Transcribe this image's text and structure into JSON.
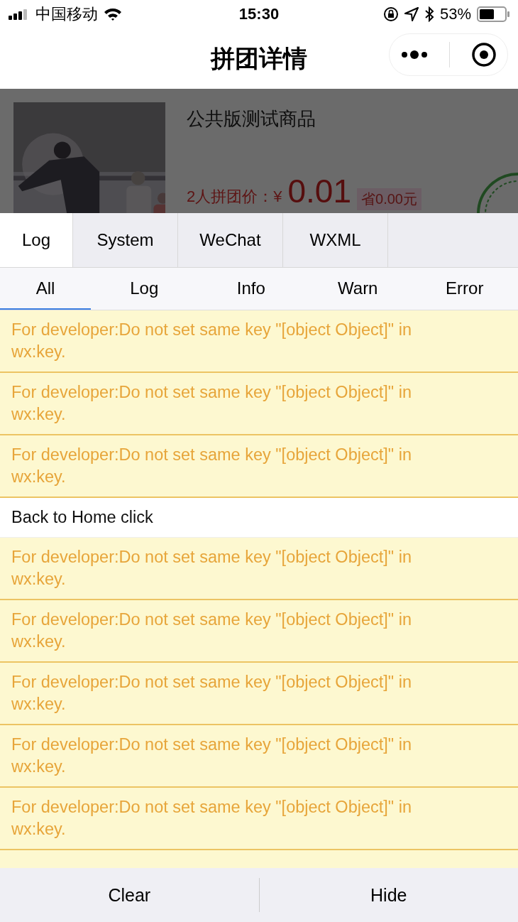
{
  "status_bar": {
    "carrier": "中国移动",
    "time": "15:30",
    "battery": "53%"
  },
  "nav": {
    "title": "拼团详情"
  },
  "product": {
    "name": "公共版测试商品",
    "group_label": "2人拼团价：¥",
    "price": "0.01",
    "saving": "省0.00元"
  },
  "console": {
    "tabs": [
      {
        "label": "Log",
        "selected": true
      },
      {
        "label": "System",
        "selected": false
      },
      {
        "label": "WeChat",
        "selected": false
      },
      {
        "label": "WXML",
        "selected": false
      }
    ],
    "filters": [
      {
        "label": "All",
        "selected": true
      },
      {
        "label": "Log",
        "selected": false
      },
      {
        "label": "Info",
        "selected": false
      },
      {
        "label": "Warn",
        "selected": false
      },
      {
        "label": "Error",
        "selected": false
      }
    ],
    "entries": [
      {
        "kind": "warn",
        "text": "For developer:Do not set same key \"[object Object]\" in wx:key."
      },
      {
        "kind": "warn",
        "text": "For developer:Do not set same key \"[object Object]\" in wx:key."
      },
      {
        "kind": "warn",
        "text": "For developer:Do not set same key \"[object Object]\" in wx:key."
      },
      {
        "kind": "log",
        "text": "Back to Home click"
      },
      {
        "kind": "warn",
        "text": "For developer:Do not set same key \"[object Object]\" in wx:key."
      },
      {
        "kind": "warn",
        "text": "For developer:Do not set same key \"[object Object]\" in wx:key."
      },
      {
        "kind": "warn",
        "text": "For developer:Do not set same key \"[object Object]\" in wx:key."
      },
      {
        "kind": "warn",
        "text": "For developer:Do not set same key \"[object Object]\" in wx:key."
      },
      {
        "kind": "warn",
        "text": "For developer:Do not set same key \"[object Object]\" in wx:key."
      }
    ],
    "buttons": [
      "Clear",
      "Hide"
    ]
  }
}
